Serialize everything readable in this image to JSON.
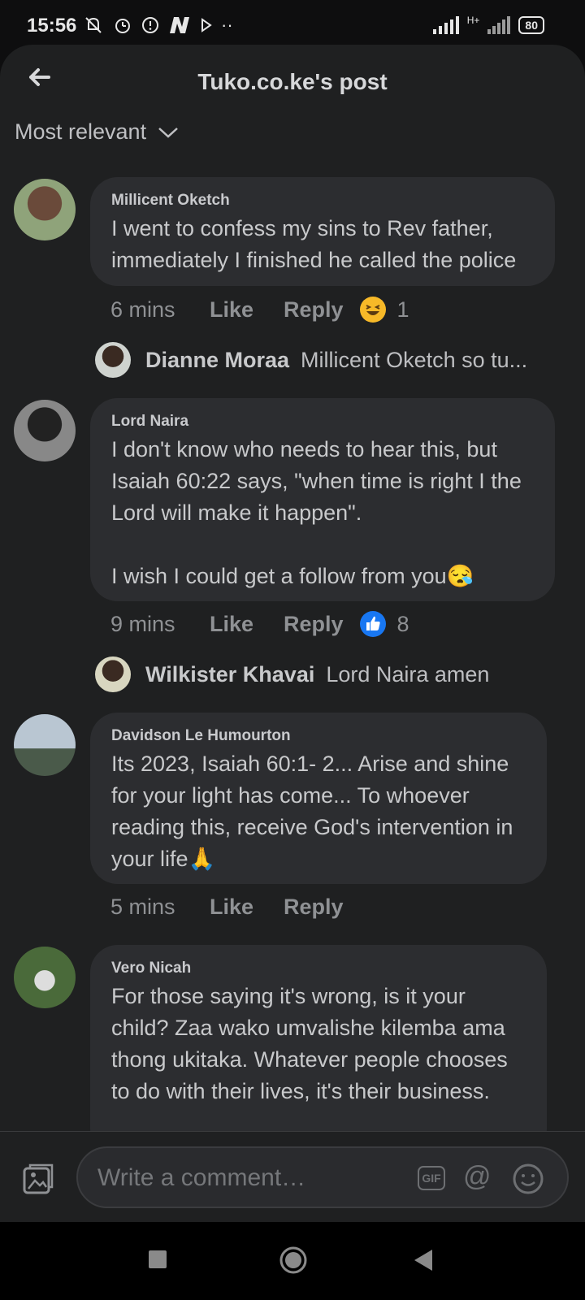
{
  "status_bar": {
    "time": "15:56",
    "battery": "80",
    "network": "H+"
  },
  "header": {
    "title": "Tuko.co.ke's post"
  },
  "sort": {
    "label": "Most relevant"
  },
  "comments": [
    {
      "name": "Millicent Oketch",
      "text": "I went to confess my sins to Rev father,\nimmediately I finished he called the police",
      "time": "6 mins",
      "like": "Like",
      "reply": "Reply",
      "reaction": "haha-emoji",
      "reaction_count": "1",
      "reply_preview": {
        "name": "Dianne Moraa",
        "text": "Millicent Oketch so tu..."
      }
    },
    {
      "name": "Lord Naira",
      "text": "I don't know who needs to hear this, but\nIsaiah 60:22 says, \"when time is right I the\nLord will make it happen\".\n\nI wish I could get a follow from you😪",
      "time": "9 mins",
      "like": "Like",
      "reply": "Reply",
      "reaction": "like-thumb",
      "reaction_count": "8",
      "reply_preview": {
        "name": "Wilkister Khavai",
        "text": "Lord Naira amen"
      }
    },
    {
      "name": "Davidson Le Humourton",
      "text": "Its 2023, Isaiah 60:1- 2... Arise and shine\nfor your light has come... To whoever\nreading this, receive God's intervention in\nyour life🙏",
      "time": "5 mins",
      "like": "Like",
      "reply": "Reply"
    },
    {
      "name": "Vero Nicah",
      "text": "For those saying it's wrong, is it your\nchild? Zaa wako umvalishe kilemba ama\nthong ukitaka. Whatever people chooses\nto do with their lives, it's their business."
    }
  ],
  "composer": {
    "placeholder": "Write a comment…",
    "gif_label": "GIF"
  },
  "colors": {
    "sheet": "#1f2021",
    "bubble": "#2c2d30",
    "like_blue": "#1877f2",
    "haha_yellow": "#f7b928"
  }
}
